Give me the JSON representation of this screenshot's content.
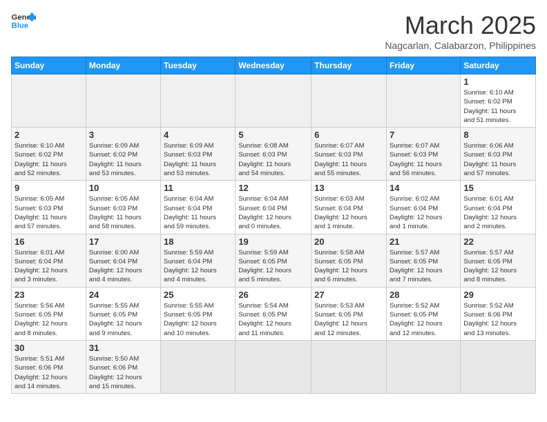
{
  "header": {
    "logo_general": "General",
    "logo_blue": "Blue",
    "month_title": "March 2025",
    "location": "Nagcarlan, Calabarzon, Philippines"
  },
  "weekdays": [
    "Sunday",
    "Monday",
    "Tuesday",
    "Wednesday",
    "Thursday",
    "Friday",
    "Saturday"
  ],
  "weeks": [
    [
      {
        "day": "",
        "info": ""
      },
      {
        "day": "",
        "info": ""
      },
      {
        "day": "",
        "info": ""
      },
      {
        "day": "",
        "info": ""
      },
      {
        "day": "",
        "info": ""
      },
      {
        "day": "",
        "info": ""
      },
      {
        "day": "1",
        "info": "Sunrise: 6:10 AM\nSunset: 6:02 PM\nDaylight: 11 hours\nand 51 minutes."
      }
    ],
    [
      {
        "day": "2",
        "info": "Sunrise: 6:10 AM\nSunset: 6:02 PM\nDaylight: 11 hours\nand 52 minutes."
      },
      {
        "day": "3",
        "info": "Sunrise: 6:09 AM\nSunset: 6:02 PM\nDaylight: 11 hours\nand 53 minutes."
      },
      {
        "day": "4",
        "info": "Sunrise: 6:09 AM\nSunset: 6:03 PM\nDaylight: 11 hours\nand 53 minutes."
      },
      {
        "day": "5",
        "info": "Sunrise: 6:08 AM\nSunset: 6:03 PM\nDaylight: 11 hours\nand 54 minutes."
      },
      {
        "day": "6",
        "info": "Sunrise: 6:07 AM\nSunset: 6:03 PM\nDaylight: 11 hours\nand 55 minutes."
      },
      {
        "day": "7",
        "info": "Sunrise: 6:07 AM\nSunset: 6:03 PM\nDaylight: 11 hours\nand 56 minutes."
      },
      {
        "day": "8",
        "info": "Sunrise: 6:06 AM\nSunset: 6:03 PM\nDaylight: 11 hours\nand 57 minutes."
      }
    ],
    [
      {
        "day": "9",
        "info": "Sunrise: 6:05 AM\nSunset: 6:03 PM\nDaylight: 11 hours\nand 57 minutes."
      },
      {
        "day": "10",
        "info": "Sunrise: 6:05 AM\nSunset: 6:03 PM\nDaylight: 11 hours\nand 58 minutes."
      },
      {
        "day": "11",
        "info": "Sunrise: 6:04 AM\nSunset: 6:04 PM\nDaylight: 11 hours\nand 59 minutes."
      },
      {
        "day": "12",
        "info": "Sunrise: 6:04 AM\nSunset: 6:04 PM\nDaylight: 12 hours\nand 0 minutes."
      },
      {
        "day": "13",
        "info": "Sunrise: 6:03 AM\nSunset: 6:04 PM\nDaylight: 12 hours\nand 1 minute."
      },
      {
        "day": "14",
        "info": "Sunrise: 6:02 AM\nSunset: 6:04 PM\nDaylight: 12 hours\nand 1 minute."
      },
      {
        "day": "15",
        "info": "Sunrise: 6:01 AM\nSunset: 6:04 PM\nDaylight: 12 hours\nand 2 minutes."
      }
    ],
    [
      {
        "day": "16",
        "info": "Sunrise: 6:01 AM\nSunset: 6:04 PM\nDaylight: 12 hours\nand 3 minutes."
      },
      {
        "day": "17",
        "info": "Sunrise: 6:00 AM\nSunset: 6:04 PM\nDaylight: 12 hours\nand 4 minutes."
      },
      {
        "day": "18",
        "info": "Sunrise: 5:59 AM\nSunset: 6:04 PM\nDaylight: 12 hours\nand 4 minutes."
      },
      {
        "day": "19",
        "info": "Sunrise: 5:59 AM\nSunset: 6:05 PM\nDaylight: 12 hours\nand 5 minutes."
      },
      {
        "day": "20",
        "info": "Sunrise: 5:58 AM\nSunset: 6:05 PM\nDaylight: 12 hours\nand 6 minutes."
      },
      {
        "day": "21",
        "info": "Sunrise: 5:57 AM\nSunset: 6:05 PM\nDaylight: 12 hours\nand 7 minutes."
      },
      {
        "day": "22",
        "info": "Sunrise: 5:57 AM\nSunset: 6:05 PM\nDaylight: 12 hours\nand 8 minutes."
      }
    ],
    [
      {
        "day": "23",
        "info": "Sunrise: 5:56 AM\nSunset: 6:05 PM\nDaylight: 12 hours\nand 8 minutes."
      },
      {
        "day": "24",
        "info": "Sunrise: 5:55 AM\nSunset: 6:05 PM\nDaylight: 12 hours\nand 9 minutes."
      },
      {
        "day": "25",
        "info": "Sunrise: 5:55 AM\nSunset: 6:05 PM\nDaylight: 12 hours\nand 10 minutes."
      },
      {
        "day": "26",
        "info": "Sunrise: 5:54 AM\nSunset: 6:05 PM\nDaylight: 12 hours\nand 11 minutes."
      },
      {
        "day": "27",
        "info": "Sunrise: 5:53 AM\nSunset: 6:05 PM\nDaylight: 12 hours\nand 12 minutes."
      },
      {
        "day": "28",
        "info": "Sunrise: 5:52 AM\nSunset: 6:05 PM\nDaylight: 12 hours\nand 12 minutes."
      },
      {
        "day": "29",
        "info": "Sunrise: 5:52 AM\nSunset: 6:06 PM\nDaylight: 12 hours\nand 13 minutes."
      }
    ],
    [
      {
        "day": "30",
        "info": "Sunrise: 5:51 AM\nSunset: 6:06 PM\nDaylight: 12 hours\nand 14 minutes."
      },
      {
        "day": "31",
        "info": "Sunrise: 5:50 AM\nSunset: 6:06 PM\nDaylight: 12 hours\nand 15 minutes."
      },
      {
        "day": "",
        "info": ""
      },
      {
        "day": "",
        "info": ""
      },
      {
        "day": "",
        "info": ""
      },
      {
        "day": "",
        "info": ""
      },
      {
        "day": "",
        "info": ""
      }
    ]
  ]
}
